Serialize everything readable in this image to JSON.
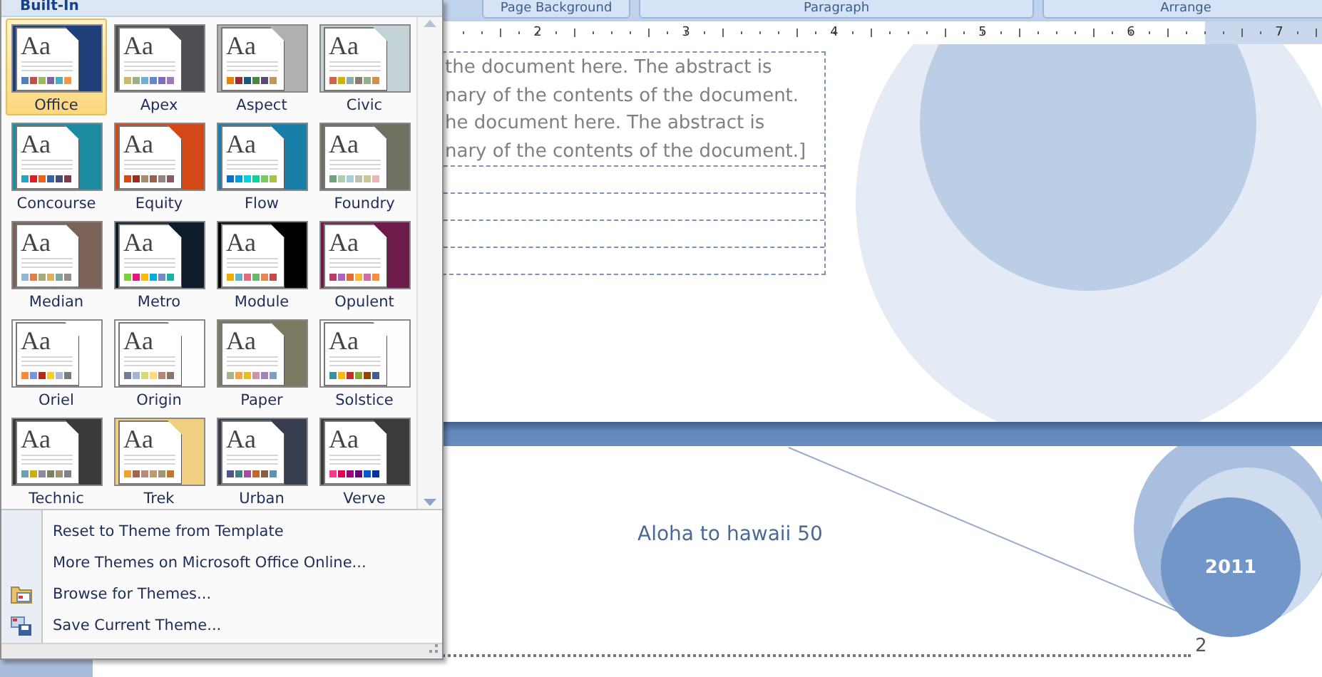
{
  "ribbon_groups": [
    "Page Background",
    "Paragraph",
    "Arrange"
  ],
  "ruler": {
    "numbers": [
      "2",
      "3",
      "4",
      "5",
      "6",
      "7"
    ]
  },
  "document": {
    "abstract_lines": [
      "the document here. The abstract is",
      "nary of the contents of the document.",
      "he document here. The abstract is",
      "nary of the contents of the document.]"
    ],
    "page2_title": "Aloha to hawaii 50",
    "year": "2011",
    "page_number": "2"
  },
  "themes_menu": {
    "header": "Built-In",
    "themes": [
      {
        "name": "Office",
        "sample": "Aa",
        "selected": true,
        "color": "#1f3f7a"
      },
      {
        "name": "Apex",
        "sample": "Aa",
        "selected": false,
        "color": "#4f4f55"
      },
      {
        "name": "Aspect",
        "sample": "Aa",
        "selected": false,
        "color": "#b0b0b0"
      },
      {
        "name": "Civic",
        "sample": "Aa",
        "selected": false,
        "color": "#c3d2d6"
      },
      {
        "name": "Concourse",
        "sample": "Aa",
        "selected": false,
        "color": "#1c8ca0"
      },
      {
        "name": "Equity",
        "sample": "Aa",
        "selected": false,
        "color": "#d34817"
      },
      {
        "name": "Flow",
        "sample": "Aa",
        "selected": false,
        "color": "#1a7fa8"
      },
      {
        "name": "Foundry",
        "sample": "Aa",
        "selected": false,
        "color": "#6f7060"
      },
      {
        "name": "Median",
        "sample": "Aa",
        "selected": false,
        "color": "#7b6258"
      },
      {
        "name": "Metro",
        "sample": "Aa",
        "selected": false,
        "color": "#0d1b2a"
      },
      {
        "name": "Module",
        "sample": "Aa",
        "selected": false,
        "color": "#000000"
      },
      {
        "name": "Opulent",
        "sample": "Aa",
        "selected": false,
        "color": "#6e1a4a"
      },
      {
        "name": "Oriel",
        "sample": "Aa",
        "selected": false,
        "color": "#ffffff"
      },
      {
        "name": "Origin",
        "sample": "Aa",
        "selected": false,
        "color": "#fefefe"
      },
      {
        "name": "Paper",
        "sample": "Aa",
        "selected": false,
        "color": "#7a7a62"
      },
      {
        "name": "Solstice",
        "sample": "Aa",
        "selected": false,
        "color": "#fdfdfd"
      },
      {
        "name": "Technic",
        "sample": "Aa",
        "selected": false,
        "color": "#3a3a3a"
      },
      {
        "name": "Trek",
        "sample": "Aa",
        "selected": false,
        "color": "#f0d080"
      },
      {
        "name": "Urban",
        "sample": "Aa",
        "selected": false,
        "color": "#363e4f"
      },
      {
        "name": "Verve",
        "sample": "Aa",
        "selected": false,
        "color": "#3b3b3b"
      }
    ],
    "items": [
      {
        "label": "Reset to Theme from Template",
        "kind": "plain"
      },
      {
        "label": "More Themes on Microsoft Office Online...",
        "kind": "plain"
      },
      {
        "label": "Browse for Themes...",
        "kind": "browse"
      },
      {
        "label": "Save Current Theme...",
        "kind": "save"
      }
    ]
  }
}
